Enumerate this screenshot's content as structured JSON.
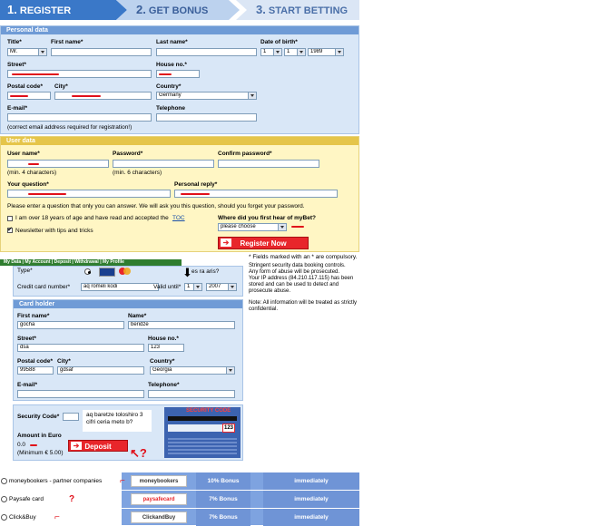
{
  "steps": [
    {
      "num": "1.",
      "label": "REGISTER"
    },
    {
      "num": "2.",
      "label": "GET BONUS"
    },
    {
      "num": "3.",
      "label": "START BETTING"
    }
  ],
  "personal": {
    "title": "Personal data",
    "labels": {
      "title": "Title*",
      "first_name": "First name*",
      "last_name": "Last name*",
      "dob": "Date of birth*",
      "street": "Street*",
      "house_no": "House no.*",
      "postal": "Postal code*",
      "city": "City*",
      "country": "Country*",
      "email": "E-mail*",
      "telephone": "Telephone"
    },
    "values": {
      "title": "Mr.",
      "dob_day": "1",
      "dob_month": "1",
      "dob_year": "1989",
      "country": "Germany"
    },
    "email_note": "(correct email address required for registration!)"
  },
  "user": {
    "title": "User data",
    "labels": {
      "username": "User name*",
      "password": "Password*",
      "confirm": "Confirm password*",
      "question": "Your question*",
      "reply": "Personal reply*",
      "heard": "Where did you first hear of myBet?"
    },
    "notes": {
      "username": "(min. 4 characters)",
      "password": "(min. 6 characters)"
    },
    "question_hint": "Please enter a question that only you can answer. We will ask you this question, should you forget your password.",
    "age_check": "I am over 18 years of age and have read and accepted the",
    "toc": "TOC",
    "newsletter": "Newsletter with tips and tricks",
    "heard_value": "please choose",
    "register_button": "Register Now",
    "required_note": "* Fields marked with an * are compulsory."
  },
  "lower": {
    "navbar": "My Data | My Account | Deposit | Withdrawal | My Profile",
    "card_type_label": "Type*",
    "card_number_label": "Credit card number*",
    "card_number_value": "aq romeli kodi",
    "valid_label": "Valid until*",
    "valid_month": "1",
    "valid_year": "2007",
    "aris_text": "es ra aris?",
    "holder_title": "Card holder",
    "holder_labels": {
      "first": "First name*",
      "name": "Name*",
      "street": "Street*",
      "house": "House no.*",
      "postal": "Postal code*",
      "city": "City*",
      "country": "Country*",
      "email": "E-mail*",
      "telephone": "Telephone*"
    },
    "holder_values": {
      "first": "gocha",
      "name": "beridze",
      "street": "dsa",
      "house": "123",
      "postal": "99588",
      "city": "gdsaf",
      "country": "Georgia"
    },
    "security_label": "Security Code*",
    "security_note": "aq baretze toloshiro 3 cifri ceria meto b?",
    "security_card_title": "SECURITY CODE",
    "security_card_number": "123",
    "amount_label": "Amount in Euro",
    "amount_value": "0.0",
    "amount_min": "(Minimum € 5.00)",
    "deposit_button": "Deposit",
    "info": [
      "Stringent security data booking controls.",
      "Any form of abuse will be prosecuted.",
      "Your IP address (84.210.117.115) has been stored and can be used to detect and prosecute abuse.",
      "Note: All information will be treated as strictly confidential."
    ]
  },
  "payments": [
    {
      "name": "moneybookers - partner companies",
      "logo": "moneybookers",
      "bonus": "10% Bonus",
      "time": "immediately"
    },
    {
      "name": "Paysafe card",
      "logo": "paysafecard",
      "bonus": "7% Bonus",
      "time": "immediately"
    },
    {
      "name": "Click&Buy",
      "logo": "ClickandBuy",
      "bonus": "7% Bonus",
      "time": "immediately"
    }
  ],
  "colors": {
    "blue_panel": "#d9e7f7",
    "yellow_panel": "#fff6c4",
    "accent_red": "#e8262b",
    "step_blue": "#3a78c8"
  }
}
